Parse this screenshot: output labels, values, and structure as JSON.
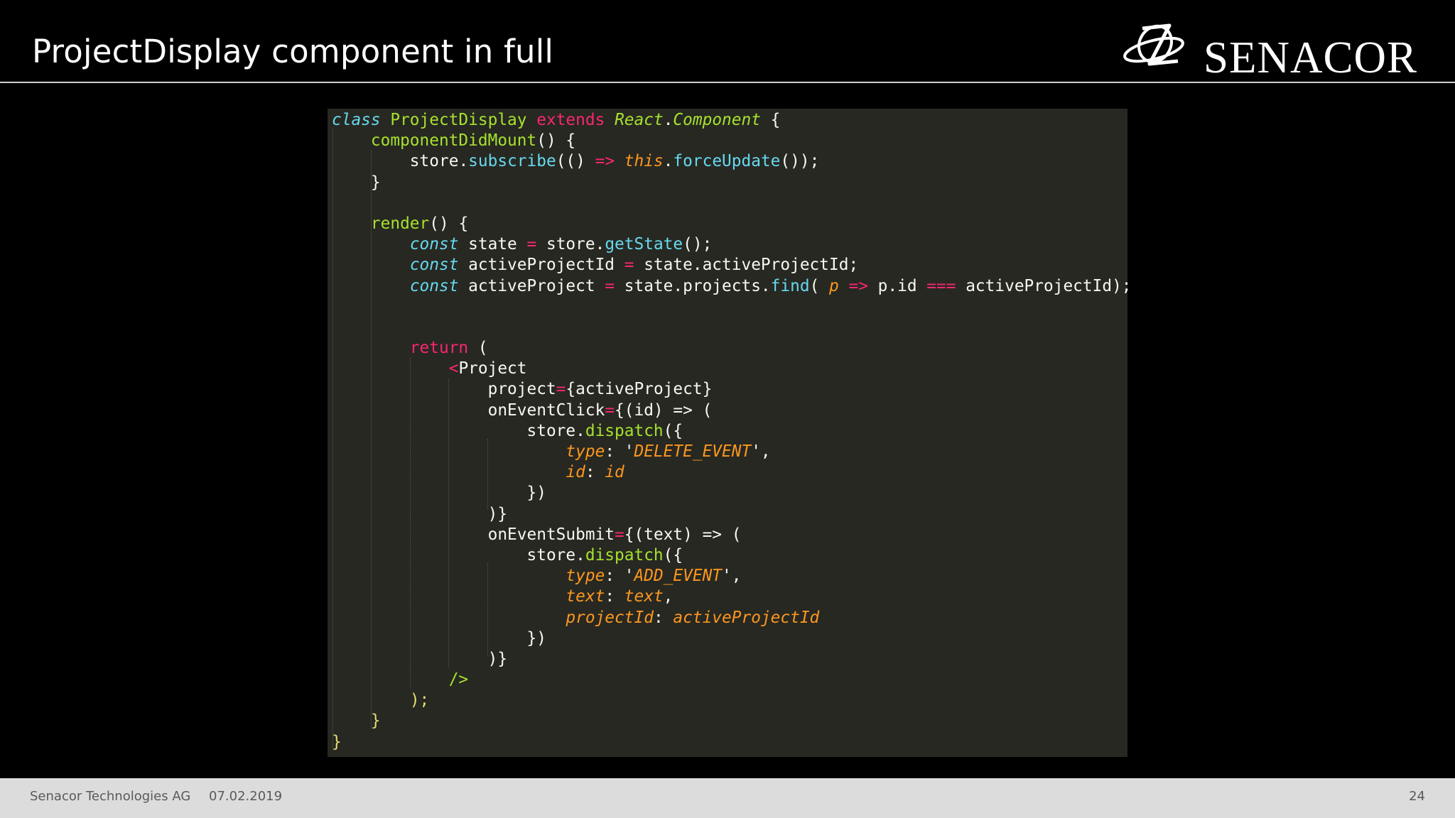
{
  "slide": {
    "title": "ProjectDisplay component in full",
    "logo_text": "SENACOR"
  },
  "code": {
    "lines": [
      [
        [
          "st",
          "class"
        ],
        [
          "tx",
          " "
        ],
        [
          "fn",
          "ProjectDisplay"
        ],
        [
          "tx",
          " "
        ],
        [
          "kw",
          "extends"
        ],
        [
          "tx",
          " "
        ],
        [
          "cl",
          "React"
        ],
        [
          "tx",
          "."
        ],
        [
          "cl",
          "Component"
        ],
        [
          "tx",
          " {"
        ]
      ],
      [
        [
          "tx",
          "    "
        ],
        [
          "fn",
          "componentDidMount"
        ],
        [
          "tx",
          "() {"
        ]
      ],
      [
        [
          "tx",
          "        store"
        ],
        [
          "tx",
          "."
        ],
        [
          "pm",
          "subscribe"
        ],
        [
          "tx",
          "(() "
        ],
        [
          "kw",
          "=>"
        ],
        [
          "tx",
          " "
        ],
        [
          "ti",
          "this"
        ],
        [
          "tx",
          "."
        ],
        [
          "pm",
          "forceUpdate"
        ],
        [
          "tx",
          "());"
        ]
      ],
      [
        [
          "tx",
          "    }"
        ]
      ],
      [
        [
          "tx",
          ""
        ]
      ],
      [
        [
          "tx",
          "    "
        ],
        [
          "fn",
          "render"
        ],
        [
          "tx",
          "() {"
        ]
      ],
      [
        [
          "tx",
          "        "
        ],
        [
          "st",
          "const"
        ],
        [
          "tx",
          " state "
        ],
        [
          "kw",
          "="
        ],
        [
          "tx",
          " store."
        ],
        [
          "pm",
          "getState"
        ],
        [
          "tx",
          "();"
        ]
      ],
      [
        [
          "tx",
          "        "
        ],
        [
          "st",
          "const"
        ],
        [
          "tx",
          " activeProjectId "
        ],
        [
          "kw",
          "="
        ],
        [
          "tx",
          " state.activeProjectId;"
        ]
      ],
      [
        [
          "tx",
          "        "
        ],
        [
          "st",
          "const"
        ],
        [
          "tx",
          " activeProject "
        ],
        [
          "kw",
          "="
        ],
        [
          "tx",
          " state.projects."
        ],
        [
          "pm",
          "find"
        ],
        [
          "tx",
          "( "
        ],
        [
          "it",
          "p"
        ],
        [
          "tx",
          " "
        ],
        [
          "kw",
          "=>"
        ],
        [
          "tx",
          " p.id "
        ],
        [
          "kw",
          "==="
        ],
        [
          "tx",
          " activeProjectId);"
        ]
      ],
      [
        [
          "tx",
          ""
        ]
      ],
      [
        [
          "tx",
          ""
        ]
      ],
      [
        [
          "tx",
          "        "
        ],
        [
          "kw",
          "return"
        ],
        [
          "tx",
          " ("
        ]
      ],
      [
        [
          "tx",
          "            "
        ],
        [
          "kw",
          "<"
        ],
        [
          "tx",
          "Project"
        ]
      ],
      [
        [
          "tx",
          "                project"
        ],
        [
          "kw",
          "="
        ],
        [
          "tx",
          "{activeProject}"
        ]
      ],
      [
        [
          "tx",
          "                onEventClick"
        ],
        [
          "kw",
          "="
        ],
        [
          "tx",
          "{(id) "
        ],
        [
          "tx",
          "=>"
        ],
        [
          "tx",
          " ("
        ]
      ],
      [
        [
          "tx",
          "                    store."
        ],
        [
          "fn",
          "dispatch"
        ],
        [
          "tx",
          "({"
        ]
      ],
      [
        [
          "tx",
          "                        "
        ],
        [
          "it",
          "type"
        ],
        [
          "tx",
          ": '"
        ],
        [
          "it",
          "DELETE_EVENT"
        ],
        [
          "tx",
          "',"
        ]
      ],
      [
        [
          "tx",
          "                        "
        ],
        [
          "it",
          "id"
        ],
        [
          "tx",
          ": "
        ],
        [
          "it",
          "id"
        ]
      ],
      [
        [
          "tx",
          "                    })"
        ]
      ],
      [
        [
          "tx",
          "                )}"
        ]
      ],
      [
        [
          "tx",
          "                onEventSubmit"
        ],
        [
          "kw",
          "="
        ],
        [
          "tx",
          "{(text) "
        ],
        [
          "tx",
          "=>"
        ],
        [
          "tx",
          " ("
        ]
      ],
      [
        [
          "tx",
          "                    store."
        ],
        [
          "fn",
          "dispatch"
        ],
        [
          "tx",
          "({"
        ]
      ],
      [
        [
          "tx",
          "                        "
        ],
        [
          "it",
          "type"
        ],
        [
          "tx",
          ": '"
        ],
        [
          "it",
          "ADD_EVENT"
        ],
        [
          "tx",
          "',"
        ]
      ],
      [
        [
          "tx",
          "                        "
        ],
        [
          "it",
          "text"
        ],
        [
          "tx",
          ": "
        ],
        [
          "it",
          "text"
        ],
        [
          "tx",
          ","
        ]
      ],
      [
        [
          "tx",
          "                        "
        ],
        [
          "it",
          "projectId"
        ],
        [
          "tx",
          ": "
        ],
        [
          "it",
          "activeProjectId"
        ]
      ],
      [
        [
          "tx",
          "                    })"
        ]
      ],
      [
        [
          "tx",
          "                )}"
        ]
      ],
      [
        [
          "tx",
          "            "
        ],
        [
          "fn",
          "/>"
        ]
      ],
      [
        [
          "tx",
          "        "
        ],
        [
          "str",
          ");"
        ]
      ],
      [
        [
          "tx",
          "    "
        ],
        [
          "str",
          "}"
        ]
      ],
      [
        [
          "str",
          "}"
        ]
      ]
    ]
  },
  "footer": {
    "company": "Senacor Technologies AG",
    "date": "07.02.2019",
    "page": "24"
  }
}
